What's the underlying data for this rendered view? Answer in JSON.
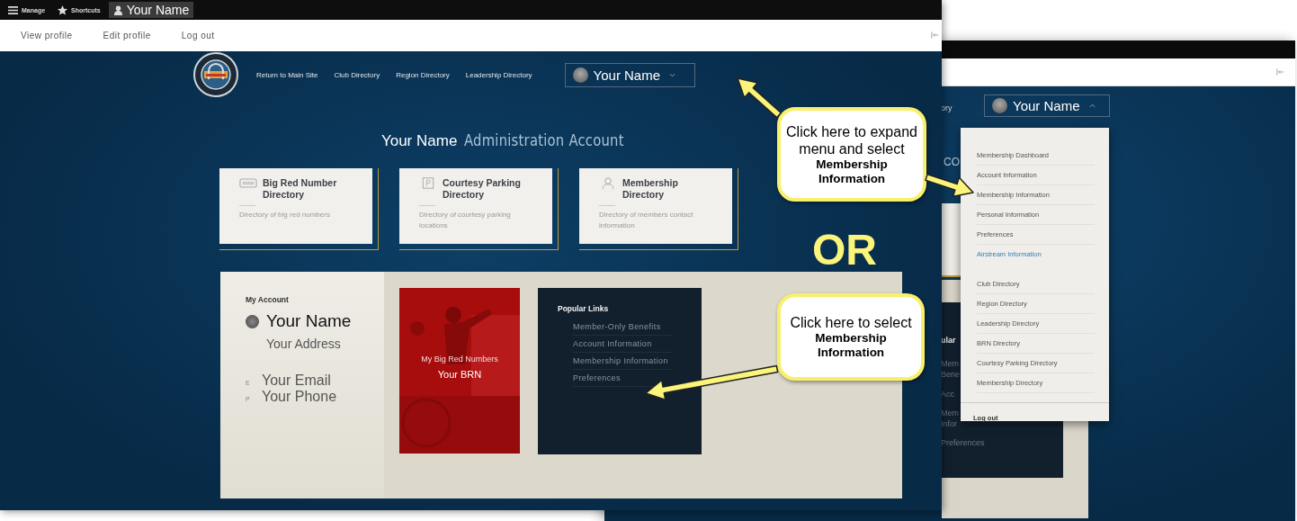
{
  "front_window": {
    "toolbar": [
      {
        "kind": "menu",
        "label": "Manage",
        "selected": false
      },
      {
        "kind": "star",
        "label": "Shortcuts",
        "selected": false
      },
      {
        "kind": "user",
        "label": "Your Name",
        "selected": true
      }
    ],
    "user_tabs": [
      "View profile",
      "Edit profile",
      "Log out"
    ],
    "nav_links": [
      "Return to Main Site",
      "Club Directory",
      "Region Directory",
      "Leadership Directory"
    ],
    "user_menu": {
      "label": "Your Name",
      "expanded": false
    },
    "heading": {
      "name": "Your Name",
      "title": "Administration Account"
    },
    "cards": [
      {
        "kind": "plate",
        "title": "Big Red Number Directory",
        "description": "Directory of big red numbers"
      },
      {
        "kind": "parking",
        "title": "Courtesy Parking Directory",
        "description": "Directory of courtesy parking locations"
      },
      {
        "kind": "person",
        "title": "Membership Directory",
        "description": "Directory of members contact information"
      }
    ],
    "account": {
      "heading": "My Account",
      "name": "Your Name",
      "address": "Your Address",
      "email_label": "E",
      "email": "Your Email",
      "phone_label": "P",
      "phone": "Your Phone"
    },
    "brn_card": {
      "kind": "picture",
      "label": "My Big Red Numbers",
      "value": "Your BRN"
    },
    "popular_links": {
      "title": "Popular Links",
      "items": [
        "Member-Only Benefits",
        "Account Information",
        "Membership Information",
        "Preferences"
      ]
    }
  },
  "back_window": {
    "nav_fragment": "ory",
    "user_menu": {
      "label": "Your Name",
      "expanded": true
    },
    "heading_fragment": "CO",
    "popular_fragments": [
      "ular",
      "Mem",
      "Bene",
      "Acc",
      "Mem",
      "Infor",
      "Preferences"
    ],
    "menu": {
      "groups": [
        [
          {
            "label": "Membership Dashboard",
            "current": false
          },
          {
            "label": "Account Information",
            "current": false
          },
          {
            "label": "Membership Information",
            "current": false
          },
          {
            "label": "Personal Information",
            "current": false
          },
          {
            "label": "Preferences",
            "current": false
          },
          {
            "label": "Airstream Information",
            "current": true
          }
        ],
        [
          {
            "label": "Club Directory",
            "current": false
          },
          {
            "label": "Region Directory",
            "current": false
          },
          {
            "label": "Leadership Directory",
            "current": false
          },
          {
            "label": "BRN Directory",
            "current": false
          },
          {
            "label": "Courtesy Parking Directory",
            "current": false
          },
          {
            "label": "Membership Directory",
            "current": false
          }
        ]
      ],
      "logout": "Log out"
    }
  },
  "callouts": [
    {
      "prompt": "Click here to expand menu and select",
      "target": "Membership Information"
    },
    {
      "prompt": "Click here to select",
      "target": "Membership Information"
    }
  ],
  "or_label": "OR"
}
